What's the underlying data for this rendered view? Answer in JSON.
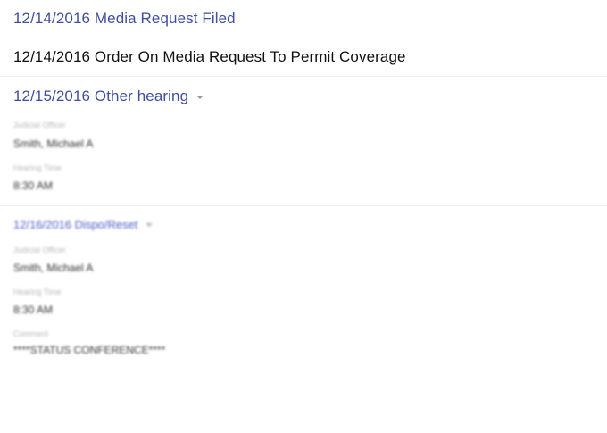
{
  "entries": [
    {
      "label": "12/14/2016 Media Request Filed"
    },
    {
      "label": "12/14/2016 Order On Media Request To Permit Coverage"
    },
    {
      "label": "12/15/2016 Other hearing"
    }
  ],
  "hearing1": {
    "judicial_officer_label": "Judicial Officer",
    "judicial_officer": "Smith, Michael A",
    "hearing_time_label": "Hearing Time",
    "hearing_time": "8:30 AM"
  },
  "hearing2": {
    "title": "12/16/2016 Dispo/Reset",
    "judicial_officer_label": "Judicial Officer",
    "judicial_officer": "Smith, Michael A",
    "hearing_time_label": "Hearing Time",
    "hearing_time": "8:30 AM",
    "comment_label": "Comment",
    "comment": "****STATUS CONFERENCE****"
  },
  "colors": {
    "link": "#3f4fa0",
    "text": "#111111"
  }
}
